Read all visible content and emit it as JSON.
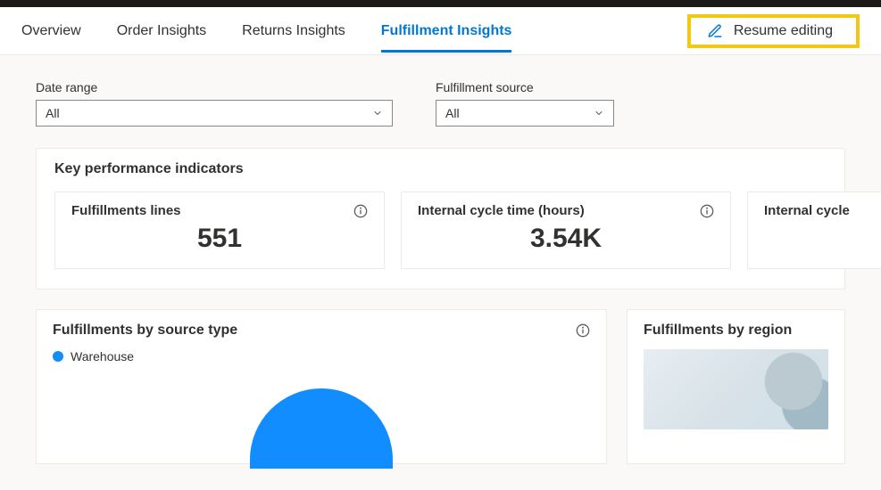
{
  "nav": {
    "tabs": [
      {
        "label": "Overview"
      },
      {
        "label": "Order Insights"
      },
      {
        "label": "Returns Insights"
      },
      {
        "label": "Fulfillment Insights",
        "active": true
      }
    ],
    "resume_label": "Resume editing"
  },
  "filters": {
    "date_range": {
      "label": "Date range",
      "value": "All"
    },
    "fulfillment_source": {
      "label": "Fulfillment source",
      "value": "All"
    }
  },
  "kpi": {
    "section_title": "Key performance indicators",
    "cards": [
      {
        "label": "Fulfillments lines",
        "value": "551"
      },
      {
        "label": "Internal cycle time (hours)",
        "value": "3.54K"
      },
      {
        "label": "Internal cycle",
        "value": ""
      }
    ]
  },
  "panels": {
    "by_source": {
      "title": "Fulfillments by source type",
      "legend": [
        {
          "label": "Warehouse",
          "color": "#118dff"
        }
      ]
    },
    "by_region": {
      "title": "Fulfillments by region"
    }
  },
  "chart_data": [
    {
      "type": "pie",
      "title": "Fulfillments by source type",
      "series": [
        {
          "name": "Warehouse",
          "value": 551,
          "color": "#118dff"
        }
      ]
    }
  ]
}
